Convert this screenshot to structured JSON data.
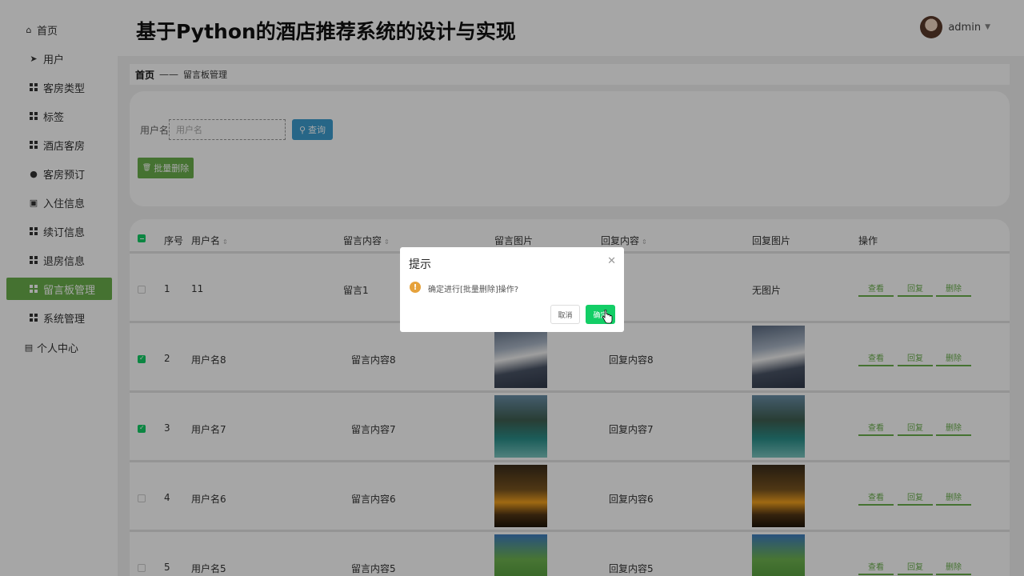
{
  "header": {
    "title": "基于Python的酒店推荐系统的设计与实现",
    "username": "admin"
  },
  "sidebar": {
    "home": "首页",
    "items": [
      {
        "label": "用户",
        "icon": "send-icon"
      },
      {
        "label": "客房类型",
        "icon": "grid-icon"
      },
      {
        "label": "标签",
        "icon": "grid-icon"
      },
      {
        "label": "酒店客房",
        "icon": "grid-icon"
      },
      {
        "label": "客房预订",
        "icon": "location-icon"
      },
      {
        "label": "入住信息",
        "icon": "clipboard-icon"
      },
      {
        "label": "续订信息",
        "icon": "grid-icon"
      },
      {
        "label": "退房信息",
        "icon": "grid-icon"
      },
      {
        "label": "留言板管理",
        "icon": "grid-icon",
        "active": true
      },
      {
        "label": "系统管理",
        "icon": "grid-icon"
      }
    ],
    "personal": "个人中心"
  },
  "breadcrumb": {
    "home": "首页",
    "separator": "——",
    "current": "留言板管理"
  },
  "search": {
    "label": "用户名",
    "placeholder": "用户名",
    "button": "查询",
    "batch_delete": "批量删除"
  },
  "table": {
    "headers": [
      "序号",
      "用户名",
      "留言内容",
      "留言图片",
      "回复内容",
      "回复图片",
      "操作"
    ],
    "rows": [
      {
        "index": "1",
        "username": "11",
        "content": "留言1",
        "reply": "",
        "reply_image_text": "无图片",
        "checked": false
      },
      {
        "index": "2",
        "username": "用户名8",
        "content": "留言内容8",
        "reply": "回复内容8",
        "checked": true,
        "image": "mountain"
      },
      {
        "index": "3",
        "username": "用户名7",
        "content": "留言内容7",
        "reply": "回复内容7",
        "checked": true,
        "image": "lake"
      },
      {
        "index": "4",
        "username": "用户名6",
        "content": "留言内容6",
        "reply": "回复内容6",
        "checked": false,
        "image": "sunset"
      },
      {
        "index": "5",
        "username": "用户名5",
        "content": "留言内容5",
        "reply": "回复内容5",
        "checked": false,
        "image": "hills"
      }
    ],
    "actions": [
      "查看",
      "回复",
      "删除"
    ]
  },
  "dialog": {
    "title": "提示",
    "message": "确定进行[批量删除]操作?",
    "cancel": "取消",
    "confirm": "确定"
  },
  "colors": {
    "primary_green": "#6ab04c",
    "confirm_green": "#13ce66",
    "search_blue": "#3c9dd0",
    "warning": "#e6a23c"
  }
}
